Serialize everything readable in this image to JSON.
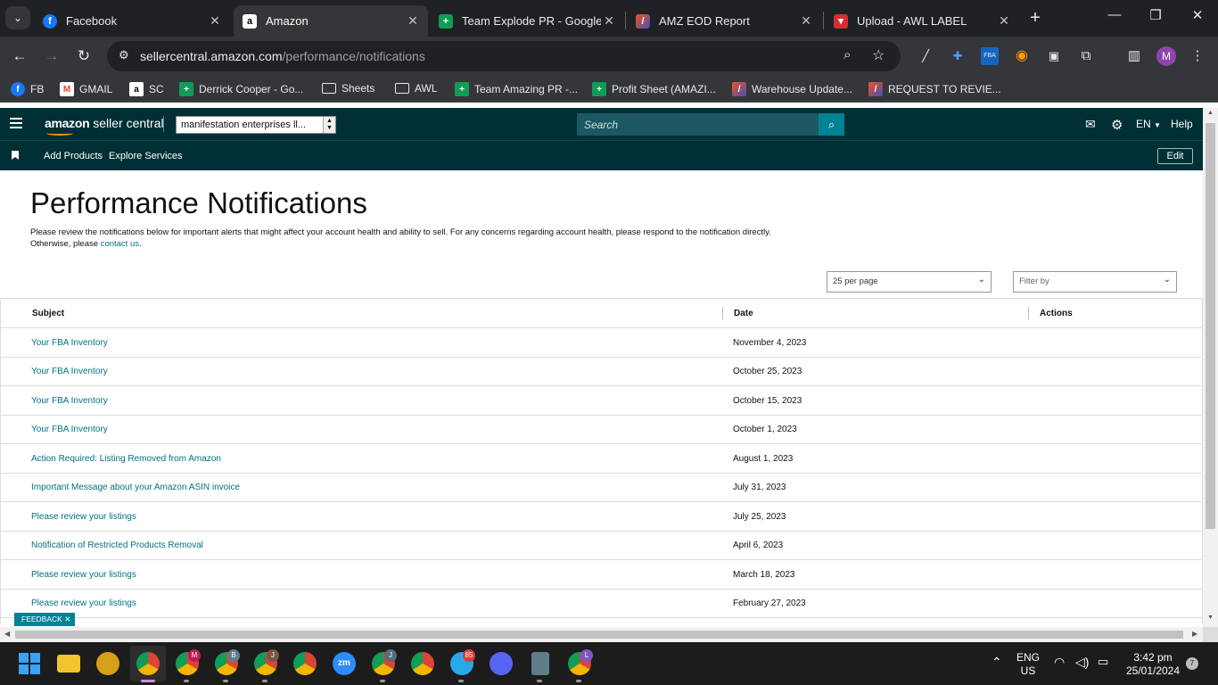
{
  "browser": {
    "tabs": [
      {
        "title": "Facebook",
        "icon": "facebook-icon",
        "color": "#1877f2"
      },
      {
        "title": "Amazon",
        "icon": "amazon-icon",
        "color": "#000000",
        "active": true
      },
      {
        "title": "Team Explode PR - Google S",
        "icon": "google-sheets-icon",
        "color": "#0f9d58"
      },
      {
        "title": "AMZ EOD Report",
        "icon": "report-icon",
        "color": "#f4511e"
      },
      {
        "title": "Upload - AWL LABEL",
        "icon": "awl-label-icon",
        "color": "#d32f2f"
      }
    ],
    "url_host": "sellercentral.amazon.com",
    "url_path": "/performance/notifications",
    "profile_initial": "M",
    "bookmarks": [
      {
        "label": "FB",
        "icon": "facebook-icon"
      },
      {
        "label": "GMAIL",
        "icon": "gmail-icon"
      },
      {
        "label": "SC",
        "icon": "amazon-icon"
      },
      {
        "label": "Derrick Cooper - Go...",
        "icon": "google-sheets-icon"
      },
      {
        "label": "Sheets",
        "icon": "folder-icon"
      },
      {
        "label": "AWL",
        "icon": "folder-icon"
      },
      {
        "label": "Team Amazing PR -...",
        "icon": "google-sheets-icon"
      },
      {
        "label": "Profit Sheet (AMAZI...",
        "icon": "google-sheets-icon"
      },
      {
        "label": "Warehouse Update...",
        "icon": "report-icon"
      },
      {
        "label": "REQUEST TO REVIE...",
        "icon": "report-icon"
      }
    ]
  },
  "seller_central": {
    "logo_bold": "amazon",
    "logo_rest": " seller central",
    "store": "manifestation enterprises ll...",
    "search_placeholder": "Search",
    "language": "EN",
    "help": "Help",
    "nav": {
      "add_products": "Add Products",
      "explore_services": "Explore Services",
      "edit": "Edit"
    }
  },
  "page": {
    "title": "Performance Notifications",
    "description": "Please review the notifications below for important alerts that might affect your account health and ability to sell. For any concerns regarding account health, please respond to the notification directly.",
    "description_line2": "Otherwise, please ",
    "contact_link": "contact us",
    "per_page": "25 per page",
    "filter": "Filter by",
    "columns": {
      "subject": "Subject",
      "date": "Date",
      "actions": "Actions"
    },
    "rows": [
      {
        "subject": "Your FBA Inventory",
        "date": "November 4, 2023"
      },
      {
        "subject": "Your FBA Inventory",
        "date": "October 25, 2023"
      },
      {
        "subject": "Your FBA Inventory",
        "date": "October 15, 2023"
      },
      {
        "subject": "Your FBA Inventory",
        "date": "October 1, 2023"
      },
      {
        "subject": "Action Required: Listing Removed from Amazon",
        "date": "August 1, 2023"
      },
      {
        "subject": "Important Message about your Amazon ASIN invoice",
        "date": "July 31, 2023"
      },
      {
        "subject": "Please review your listings",
        "date": "July 25, 2023"
      },
      {
        "subject": "Notification of Restricted Products Removal",
        "date": "April 6, 2023"
      },
      {
        "subject": "Please review your listings",
        "date": "March 18, 2023"
      },
      {
        "subject": "Please review your listings",
        "date": "February 27, 2023"
      }
    ],
    "feedback": "FEEDBACK"
  },
  "taskbar": {
    "language": "ENG",
    "region": "US",
    "time": "3:42 pm",
    "date": "25/01/2024",
    "notification_count": "7",
    "badges": {
      "chrome_m": "M",
      "chrome_b": "B",
      "chrome_j": "J",
      "chrome_j2": "J",
      "telegram": "85",
      "chrome_l": "L"
    }
  },
  "colors": {
    "header": "#002f36",
    "link": "#007185",
    "accent": "#008296"
  }
}
